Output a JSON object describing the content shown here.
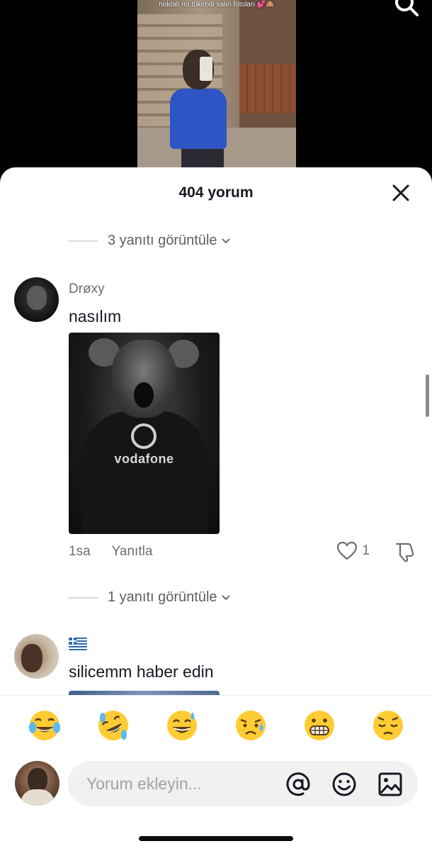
{
  "video": {
    "caption": "noktalı mı tükendi salın fotoları 💕🙈"
  },
  "sheet": {
    "title": "404 yorum"
  },
  "replies_top": {
    "label": "3 yanıtı görüntüle"
  },
  "comment1": {
    "username": "Drøxy",
    "text": "nasılım",
    "image_brand": "vodafone",
    "time": "1sa",
    "reply_label": "Yanıtla",
    "like_count": "1"
  },
  "replies_mid": {
    "label": "1 yanıtı görüntüle"
  },
  "comment2": {
    "text": "silicemm haber edin",
    "flag": "greece-flag"
  },
  "emojis": [
    "😂",
    "🤣",
    "😅",
    "😥",
    "😬",
    "😔"
  ],
  "input": {
    "placeholder": "Yorum ekleyin..."
  },
  "colors": {
    "text_primary": "#161823",
    "text_secondary": "#6e6f76",
    "input_bg": "#f1f1f2"
  }
}
